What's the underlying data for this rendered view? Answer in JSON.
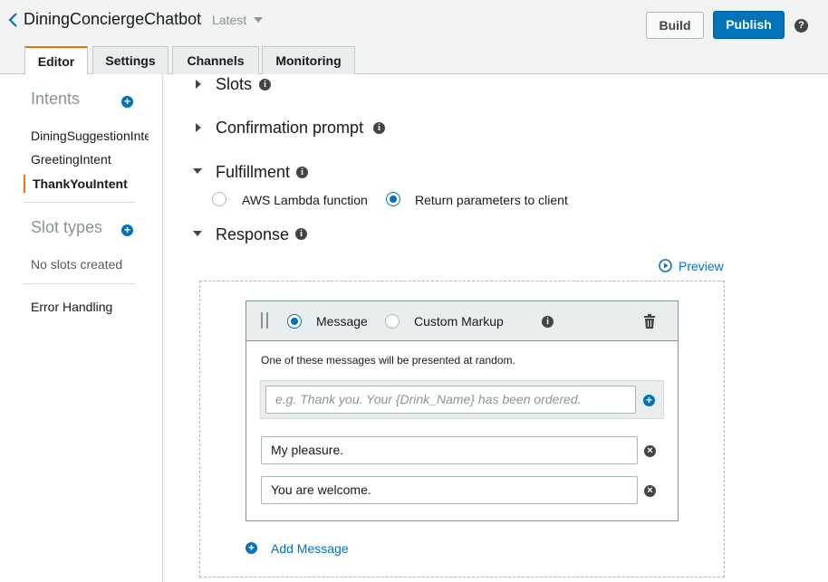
{
  "header": {
    "bot_name": "DiningConciergeChatbot",
    "version": "Latest",
    "build_label": "Build",
    "publish_label": "Publish",
    "help_icon": "?"
  },
  "tabs": [
    {
      "label": "Editor",
      "active": true
    },
    {
      "label": "Settings"
    },
    {
      "label": "Channels"
    },
    {
      "label": "Monitoring"
    }
  ],
  "sidebar": {
    "intents_heading": "Intents",
    "intents": [
      "DiningSuggestionIntent",
      "GreetingIntent",
      "ThankYouIntent"
    ],
    "slot_types_heading": "Slot types",
    "no_slots_text": "No slots created",
    "error_handling": "Error Handling"
  },
  "sections": {
    "slots": "Slots",
    "confirmation_prompt": "Confirmation prompt",
    "fulfillment": "Fulfillment",
    "response": "Response"
  },
  "fulfillment": {
    "option_lambda": "AWS Lambda function",
    "option_client": "Return parameters to client",
    "selected": "client"
  },
  "response": {
    "preview_label": "Preview",
    "type_message": "Message",
    "type_custom": "Custom Markup",
    "selected_type": "message",
    "random_note": "One of these messages will be presented at random.",
    "input_placeholder": "e.g. Thank you. Your {Drink_Name} has been ordered.",
    "messages": [
      "My pleasure.",
      "You are welcome."
    ],
    "add_message_label": "Add Message"
  },
  "colors": {
    "accent": "#0073bb",
    "active_tab": "#ec7211",
    "background": "#f2f3f3"
  }
}
